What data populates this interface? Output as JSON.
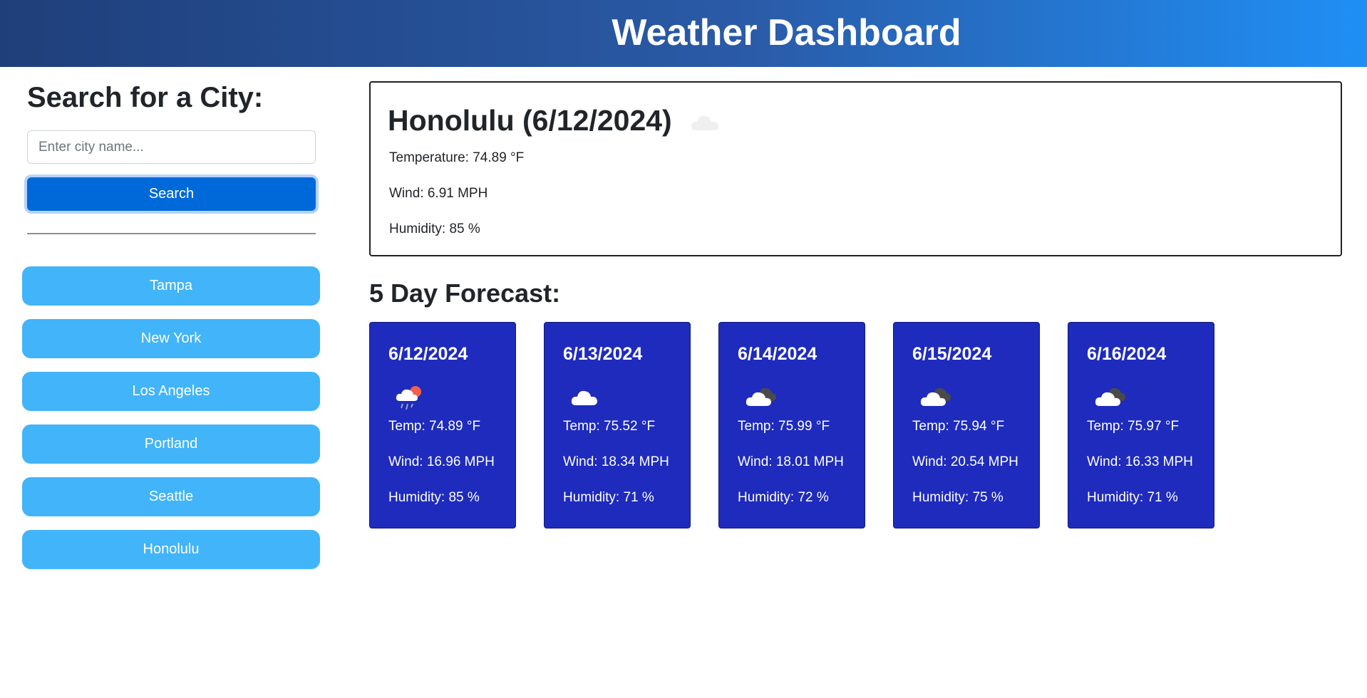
{
  "header": {
    "title": "Weather Dashboard"
  },
  "search": {
    "title": "Search for a City:",
    "placeholder": "Enter city name...",
    "value": "",
    "button_label": "Search"
  },
  "history": [
    "Tampa",
    "New York",
    "Los Angeles",
    "Portland",
    "Seattle",
    "Honolulu"
  ],
  "current": {
    "title": "Honolulu (6/12/2024)",
    "icon": "cloud-icon",
    "temperature": "Temperature: 74.89 °F",
    "wind": "Wind: 6.91 MPH",
    "humidity": "Humidity: 85 %"
  },
  "forecast": {
    "title": "5 Day Forecast:",
    "days": [
      {
        "date": "6/12/2024",
        "icon": "rain-sun-icon",
        "temp": "Temp: 74.89 °F",
        "wind": "Wind: 16.96 MPH",
        "humidity": "Humidity: 85 %"
      },
      {
        "date": "6/13/2024",
        "icon": "cloud-icon",
        "temp": "Temp: 75.52 °F",
        "wind": "Wind: 18.34 MPH",
        "humidity": "Humidity: 71 %"
      },
      {
        "date": "6/14/2024",
        "icon": "broken-clouds-icon",
        "temp": "Temp: 75.99 °F",
        "wind": "Wind: 18.01 MPH",
        "humidity": "Humidity: 72 %"
      },
      {
        "date": "6/15/2024",
        "icon": "broken-clouds-icon",
        "temp": "Temp: 75.94 °F",
        "wind": "Wind: 20.54 MPH",
        "humidity": "Humidity: 75 %"
      },
      {
        "date": "6/16/2024",
        "icon": "broken-clouds-icon",
        "temp": "Temp: 75.97 °F",
        "wind": "Wind: 16.33 MPH",
        "humidity": "Humidity: 71 %"
      }
    ]
  },
  "colors": {
    "header_start": "#1f3f7a",
    "header_end": "#1f8ff5",
    "search_button": "#0069d9",
    "history_button": "#42b4f9",
    "forecast_card": "#1e2bbd"
  }
}
